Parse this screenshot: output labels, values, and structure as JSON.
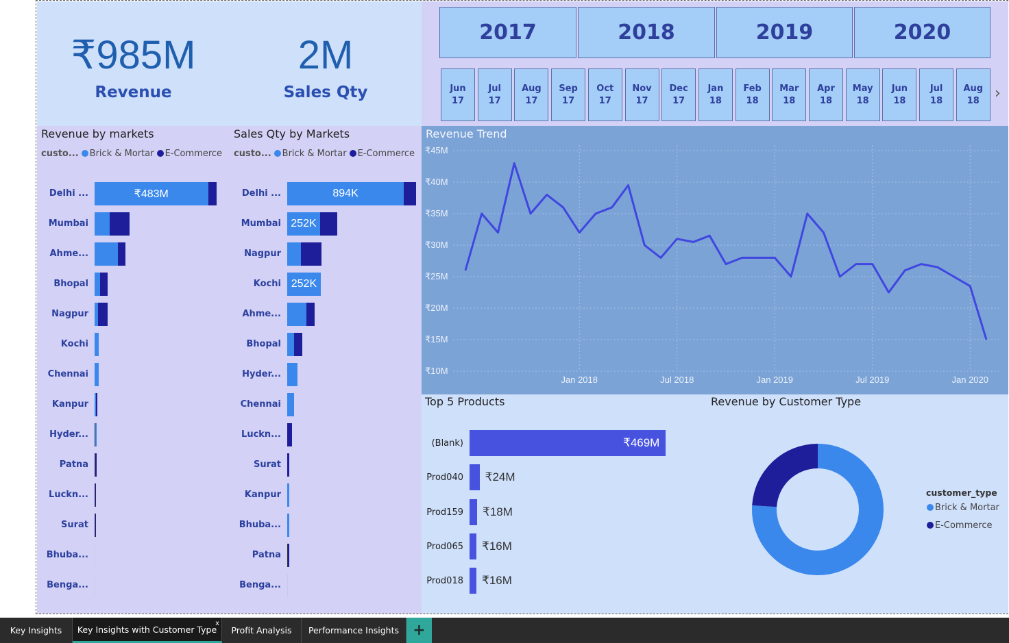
{
  "kpis": {
    "revenue_value": "₹985M",
    "revenue_label": "Revenue",
    "qty_value": "2M",
    "qty_label": "Sales Qty"
  },
  "years": [
    "2017",
    "2018",
    "2019",
    "2020"
  ],
  "months": [
    [
      "Jun",
      "17"
    ],
    [
      "Jul",
      "17"
    ],
    [
      "Aug",
      "17"
    ],
    [
      "Sep",
      "17"
    ],
    [
      "Oct",
      "17"
    ],
    [
      "Nov",
      "17"
    ],
    [
      "Dec",
      "17"
    ],
    [
      "Jan",
      "18"
    ],
    [
      "Feb",
      "18"
    ],
    [
      "Mar",
      "18"
    ],
    [
      "Apr",
      "18"
    ],
    [
      "May",
      "18"
    ],
    [
      "Jun",
      "18"
    ],
    [
      "Jul",
      "18"
    ],
    [
      "Aug",
      "18"
    ]
  ],
  "colors": {
    "brick": "#3a88ec",
    "ecom": "#1e1e9a",
    "trend_line": "#4046e0",
    "product_bar": "#4752de"
  },
  "legend": {
    "field": "custo...",
    "brick": "Brick & Mortar",
    "ecom": "E-Commerce"
  },
  "revenue_by_markets": {
    "title": "Revenue by markets",
    "rows": [
      {
        "label": "Delhi ...",
        "bm": 0.93,
        "ec": 0.07,
        "value_label": "₹483M"
      },
      {
        "label": "Mumbai",
        "bm": 0.126,
        "ec": 0.163,
        "value_label": ""
      },
      {
        "label": "Ahme...",
        "bm": 0.193,
        "ec": 0.06,
        "value_label": ""
      },
      {
        "label": "Bhopal",
        "bm": 0.045,
        "ec": 0.063,
        "value_label": ""
      },
      {
        "label": "Nagpur",
        "bm": 0.03,
        "ec": 0.075,
        "value_label": ""
      },
      {
        "label": "Kochi",
        "bm": 0.035,
        "ec": 0.0,
        "value_label": ""
      },
      {
        "label": "Chennai",
        "bm": 0.035,
        "ec": 0.0,
        "value_label": ""
      },
      {
        "label": "Kanpur",
        "bm": 0.012,
        "ec": 0.012,
        "value_label": ""
      },
      {
        "label": "Hyder...",
        "bm": 0.012,
        "ec": 0.0,
        "value_label": ""
      },
      {
        "label": "Patna",
        "bm": 0.0,
        "ec": 0.01,
        "value_label": ""
      },
      {
        "label": "Luckn...",
        "bm": 0.0,
        "ec": 0.006,
        "value_label": ""
      },
      {
        "label": "Surat",
        "bm": 0.0,
        "ec": 0.006,
        "value_label": ""
      },
      {
        "label": "Bhuba...",
        "bm": 0.0,
        "ec": 0.0,
        "value_label": ""
      },
      {
        "label": "Benga...",
        "bm": 0.0,
        "ec": 0.0,
        "value_label": ""
      }
    ]
  },
  "sales_qty_by_markets": {
    "title": "Sales Qty by Markets",
    "rows": [
      {
        "label": "Delhi ...",
        "bm": 0.905,
        "ec": 0.095,
        "value_label": "894K"
      },
      {
        "label": "Mumbai",
        "bm": 0.255,
        "ec": 0.133,
        "value_label": "252K"
      },
      {
        "label": "Nagpur",
        "bm": 0.106,
        "ec": 0.16,
        "value_label": ""
      },
      {
        "label": "Kochi",
        "bm": 0.26,
        "ec": 0.0,
        "value_label": "252K"
      },
      {
        "label": "Ahme...",
        "bm": 0.148,
        "ec": 0.064,
        "value_label": ""
      },
      {
        "label": "Bhopal",
        "bm": 0.053,
        "ec": 0.064,
        "value_label": ""
      },
      {
        "label": "Hyder...",
        "bm": 0.08,
        "ec": 0.0,
        "value_label": ""
      },
      {
        "label": "Chennai",
        "bm": 0.053,
        "ec": 0.0,
        "value_label": ""
      },
      {
        "label": "Luckn...",
        "bm": 0.0,
        "ec": 0.037,
        "value_label": ""
      },
      {
        "label": "Surat",
        "bm": 0.0,
        "ec": 0.016,
        "value_label": ""
      },
      {
        "label": "Kanpur",
        "bm": 0.016,
        "ec": 0.0,
        "value_label": ""
      },
      {
        "label": "Bhuba...",
        "bm": 0.016,
        "ec": 0.0,
        "value_label": ""
      },
      {
        "label": "Patna",
        "bm": 0.0,
        "ec": 0.008,
        "value_label": ""
      },
      {
        "label": "Benga...",
        "bm": 0.0,
        "ec": 0.0,
        "value_label": ""
      }
    ]
  },
  "chart_data": [
    {
      "type": "line",
      "title": "Revenue Trend",
      "ytick_labels": [
        "₹10M",
        "₹15M",
        "₹20M",
        "₹25M",
        "₹30M",
        "₹35M",
        "₹40M",
        "₹45M"
      ],
      "yticks": [
        10,
        15,
        20,
        25,
        30,
        35,
        40,
        45
      ],
      "ylim": [
        10,
        45
      ],
      "xtick_labels": [
        "Jan 2018",
        "Jul 2018",
        "Jan 2019",
        "Jul 2019",
        "Jan 2020"
      ],
      "xtick_index": [
        7,
        13,
        19,
        25,
        31
      ],
      "x": [
        "2017-10",
        "2017-11",
        "2017-12",
        "2018-01",
        "2018-02",
        "2018-03",
        "2018-04",
        "2018-05",
        "2018-06",
        "2018-07",
        "2018-08",
        "2018-09",
        "2018-10",
        "2018-11",
        "2018-12",
        "2019-01",
        "2019-02",
        "2019-03",
        "2019-04",
        "2019-05",
        "2019-06",
        "2019-07",
        "2019-08",
        "2019-09",
        "2019-10",
        "2019-11",
        "2019-12",
        "2020-01",
        "2020-02",
        "2020-03",
        "2020-04",
        "2020-05",
        "2020-06",
        "2020-07"
      ],
      "values": [
        26,
        35,
        32,
        43,
        35,
        38,
        36,
        32,
        35,
        36,
        39.5,
        30,
        28,
        31,
        30.5,
        31.5,
        27,
        28,
        28,
        28,
        25,
        35,
        32,
        25,
        27,
        27,
        22.5,
        26,
        27,
        26.5,
        25,
        23.5,
        15
      ],
      "grid": true
    },
    {
      "type": "bar",
      "title": "Top 5 Products",
      "categories": [
        "(Blank)",
        "Prod040",
        "Prod159",
        "Prod065",
        "Prod018"
      ],
      "values": [
        469,
        24,
        18,
        16,
        16
      ],
      "value_labels": [
        "₹469M",
        "₹24M",
        "₹18M",
        "₹16M",
        "₹16M"
      ]
    },
    {
      "type": "pie",
      "title": "Revenue by Customer Type",
      "legend_title": "customer_type",
      "categories": [
        "Brick & Mortar",
        "E-Commerce"
      ],
      "values": [
        0.76,
        0.24
      ],
      "legend_position": "right"
    }
  ],
  "tabs": [
    {
      "label": "Key Insights",
      "active": false
    },
    {
      "label": "Key Insights with Customer Type",
      "active": true
    },
    {
      "label": "Profit Analysis",
      "active": false
    },
    {
      "label": "Performance Insights",
      "active": false
    }
  ],
  "tab_close": "x",
  "tab_add": "+",
  "chevron": "›"
}
